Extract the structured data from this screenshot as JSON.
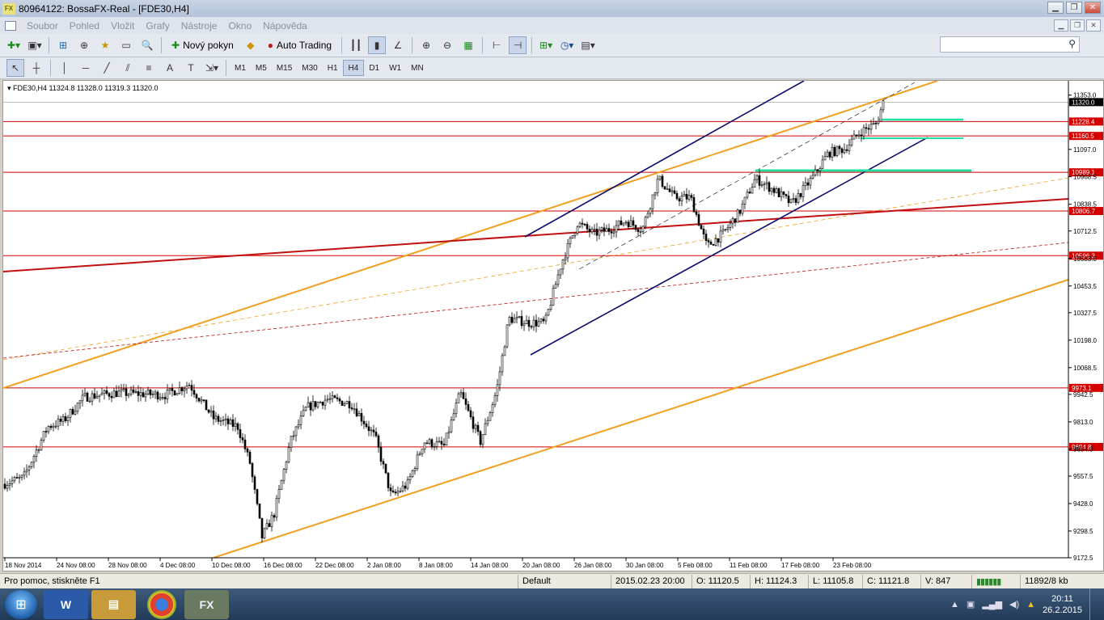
{
  "window": {
    "title": "80964122: BossaFX-Real - [FDE30,H4]",
    "app_icon": "FX"
  },
  "menu": {
    "items": [
      "Soubor",
      "Pohled",
      "Vložit",
      "Grafy",
      "Nástroje",
      "Okno",
      "Nápověda"
    ]
  },
  "toolbar1": {
    "new_order_label": "Nový pokyn",
    "auto_trading_label": "Auto Trading"
  },
  "search": {
    "placeholder": ""
  },
  "timeframes": [
    "M1",
    "M5",
    "M15",
    "M30",
    "H1",
    "H4",
    "D1",
    "W1",
    "MN"
  ],
  "active_timeframe": "H4",
  "chart": {
    "info": "FDE30,H4  11324.8 11328.0 11319.3 11320.0",
    "current_price": "11320.0",
    "price_scale": {
      "min": 9172.5,
      "max": 11405,
      "ticks": [
        "11353.0",
        "11097.0",
        "10968.5",
        "10838.5",
        "10712.5",
        "10583.0",
        "10453.5",
        "10327.5",
        "10198.0",
        "10068.5",
        "9942.5",
        "9813.0",
        "9684.0",
        "9557.5",
        "9428.0",
        "9298.5",
        "9172.5"
      ]
    },
    "level_labels": [
      "11228.4",
      "11160.5",
      "10989.1",
      "10806.7",
      "10596.3",
      "9973.1",
      "9694.8"
    ],
    "date_labels": [
      "18 Nov 2014",
      "24 Nov 08:00",
      "28 Nov 08:00",
      "4 Dec 08:00",
      "10 Dec 08:00",
      "16 Dec 08:00",
      "22 Dec 08:00",
      "2 Jan 08:00",
      "8 Jan 08:00",
      "14 Jan 08:00",
      "20 Jan 08:00",
      "26 Jan 08:00",
      "30 Jan 08:00",
      "5 Feb 08:00",
      "11 Feb 08:00",
      "17 Feb 08:00",
      "23 Feb 08:00"
    ],
    "colors": {
      "level": "#d40000",
      "trend": "#f0a020",
      "channel": "#0b0b6e",
      "target": "#20e0a0",
      "candle": "#000000",
      "label_bg": "#d40000",
      "current_bg": "#000000"
    }
  },
  "chart_data": {
    "type": "candlestick",
    "x_range": [
      "18 Nov 2014",
      "26.2.2015"
    ],
    "y_range": [
      9172.5,
      11405
    ],
    "horizontal_levels": [
      11228.4,
      11160.5,
      10989.1,
      10806.7,
      10596.3,
      9973.1,
      9694.8
    ],
    "last_close": 11320.0,
    "timeframe": "H4",
    "symbol": "FDE30"
  },
  "status": {
    "help": "Pro pomoc, stiskněte F1",
    "profile": "Default",
    "datetime": "2015.02.23 20:00",
    "open": "O: 11120.5",
    "high": "H: 11124.3",
    "low": "L: 11105.8",
    "close": "C: 11121.8",
    "volume": "V: 847",
    "traffic": "11892/8 kb"
  },
  "taskbar": {
    "apps": [
      "start-orb",
      "word",
      "explorer",
      "chrome",
      "fx"
    ],
    "time": "20:11",
    "date": "26.2.2015"
  }
}
